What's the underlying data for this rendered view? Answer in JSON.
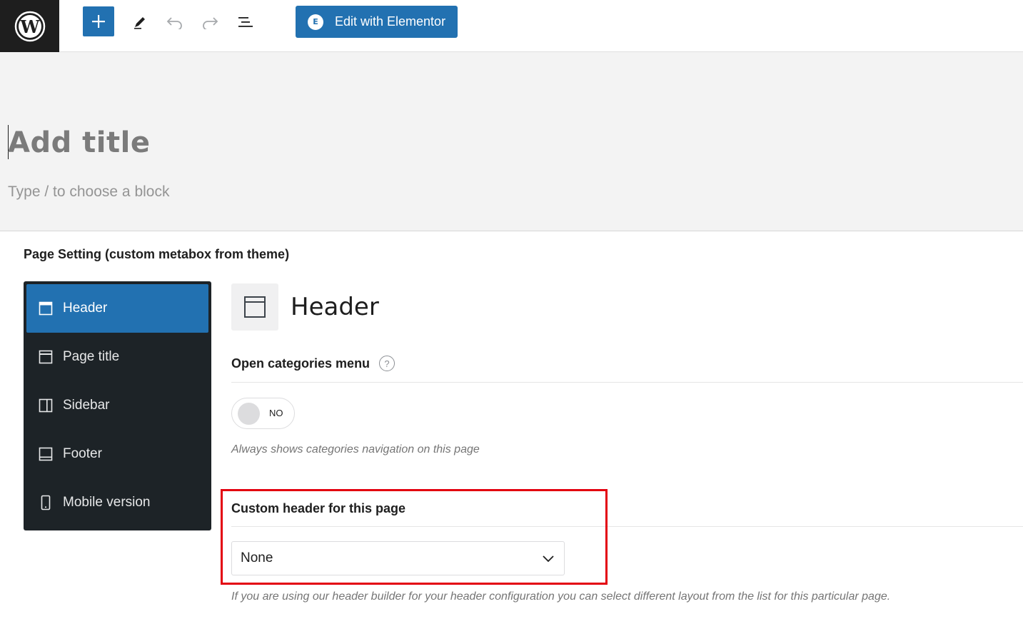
{
  "toolbar": {
    "wordpress_logo": "wordpress-icon",
    "add_block": "plus-icon",
    "tools": "pen-icon",
    "undo": "undo-icon",
    "redo": "redo-icon",
    "list_view": "list-view-icon",
    "elementor_label": "Edit with Elementor",
    "elementor_icon_text": "E",
    "accent": "#2271b1"
  },
  "editor": {
    "title_placeholder": "Add title",
    "block_hint": "Type / to choose a block"
  },
  "metabox": {
    "title": "Page Setting (custom metabox from theme)",
    "nav": [
      {
        "label": "Header",
        "icon": "header-layout-icon",
        "active": true
      },
      {
        "label": "Page title",
        "icon": "page-title-icon",
        "active": false
      },
      {
        "label": "Sidebar",
        "icon": "sidebar-icon",
        "active": false
      },
      {
        "label": "Footer",
        "icon": "footer-icon",
        "active": false
      },
      {
        "label": "Mobile version",
        "icon": "mobile-icon",
        "active": false
      }
    ],
    "section_title": "Header",
    "open_categories": {
      "label": "Open categories menu",
      "help": "?",
      "toggle_value": "NO",
      "description": "Always shows categories navigation on this page"
    },
    "custom_header": {
      "label": "Custom header for this page",
      "selected": "None",
      "description": "If you are using our header builder for your header configuration you can select different layout from the list for this particular page."
    },
    "highlight_color": "#e3000f"
  }
}
